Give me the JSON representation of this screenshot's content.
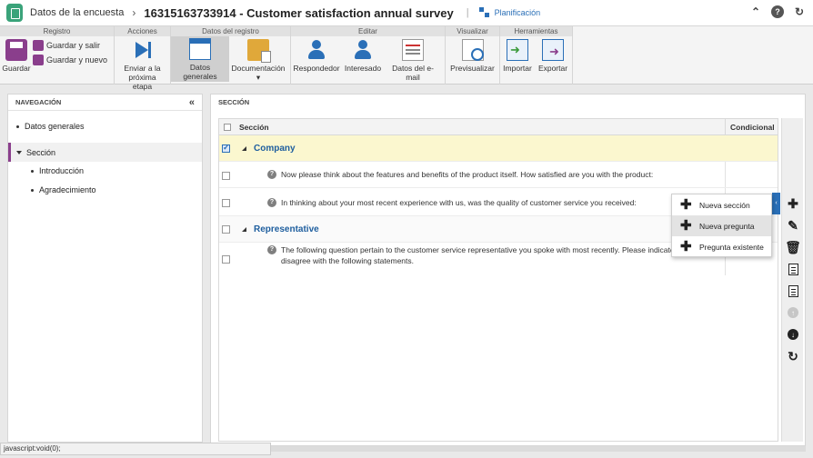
{
  "titlebar": {
    "breadcrumb_root": "Datos de la encuesta",
    "separator": "›",
    "document_title": "16315163733914 - Customer satisfaction annual survey",
    "planning_label": "Planificación"
  },
  "ribbon": {
    "groups": {
      "registro": "Registro",
      "acciones": "Acciones",
      "datos_registro": "Datos del registro",
      "editar": "Editar",
      "visualizar": "Visualizar",
      "herramientas": "Herramientas"
    },
    "buttons": {
      "guardar": "Guardar",
      "guardar_salir": "Guardar y salir",
      "guardar_nuevo": "Guardar y nuevo",
      "enviar_1": "Enviar a la",
      "enviar_2": "próxima etapa",
      "datos_generales": "Datos generales",
      "documentacion": "Documentación",
      "respondedor": "Respondedor",
      "interesado": "Interesado",
      "datos_email": "Datos del e-mail",
      "previsualizar": "Previsualizar",
      "importar": "Importar",
      "exportar": "Exportar"
    }
  },
  "navigation": {
    "header": "NAVEGACIÓN",
    "collapse_glyph": "«",
    "items": [
      {
        "label": "Datos generales"
      },
      {
        "label": "Sección"
      },
      {
        "label": "Introducción"
      },
      {
        "label": "Agradecimiento"
      }
    ]
  },
  "section_panel": {
    "header": "SECCIÓN",
    "columns": {
      "section": "Sección",
      "conditional": "Condicional"
    },
    "rows": [
      {
        "type": "section",
        "text": "Company",
        "checked": true
      },
      {
        "type": "question",
        "text": "Now please think about the features and benefits of the product itself. How satisfied are you with the product:"
      },
      {
        "type": "question",
        "text": "In thinking about your most recent experience with us, was the quality of customer service you received:"
      },
      {
        "type": "section",
        "text": "Representative",
        "checked": false
      },
      {
        "type": "question",
        "text": "The following question pertain to the customer service representative you spoke with most recently. Please indicate ... agree or disagree with the following statements."
      }
    ]
  },
  "popup_menu": {
    "items": [
      "Nueva sección",
      "Nueva pregunta",
      "Pregunta existente"
    ]
  },
  "statusbar": {
    "text": "javascript:void(0);"
  }
}
